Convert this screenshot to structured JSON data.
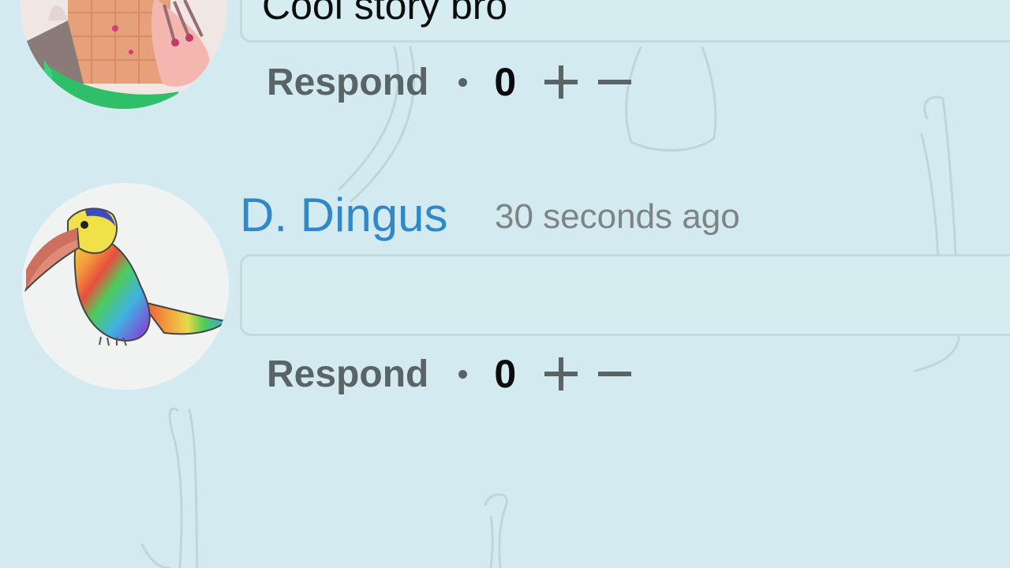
{
  "comments": [
    {
      "author": "",
      "timestamp": "",
      "text": "Cool story bro",
      "avatar": "person-photo-avatar",
      "actions": {
        "respond_label": "Respond",
        "score": "0",
        "upvote_icon": "plus-icon",
        "downvote_icon": "minus-icon"
      }
    },
    {
      "author": "D. Dingus",
      "timestamp": "30 seconds ago",
      "text": "",
      "avatar": "toucan-drawing-avatar",
      "actions": {
        "respond_label": "Respond",
        "score": "0",
        "upvote_icon": "plus-icon",
        "downvote_icon": "minus-icon"
      }
    }
  ],
  "colors": {
    "background": "#d3ebf0",
    "author": "#3188c9",
    "timestamp": "#7c8486",
    "action": "#5a6466",
    "score": "#0b0b0b"
  }
}
